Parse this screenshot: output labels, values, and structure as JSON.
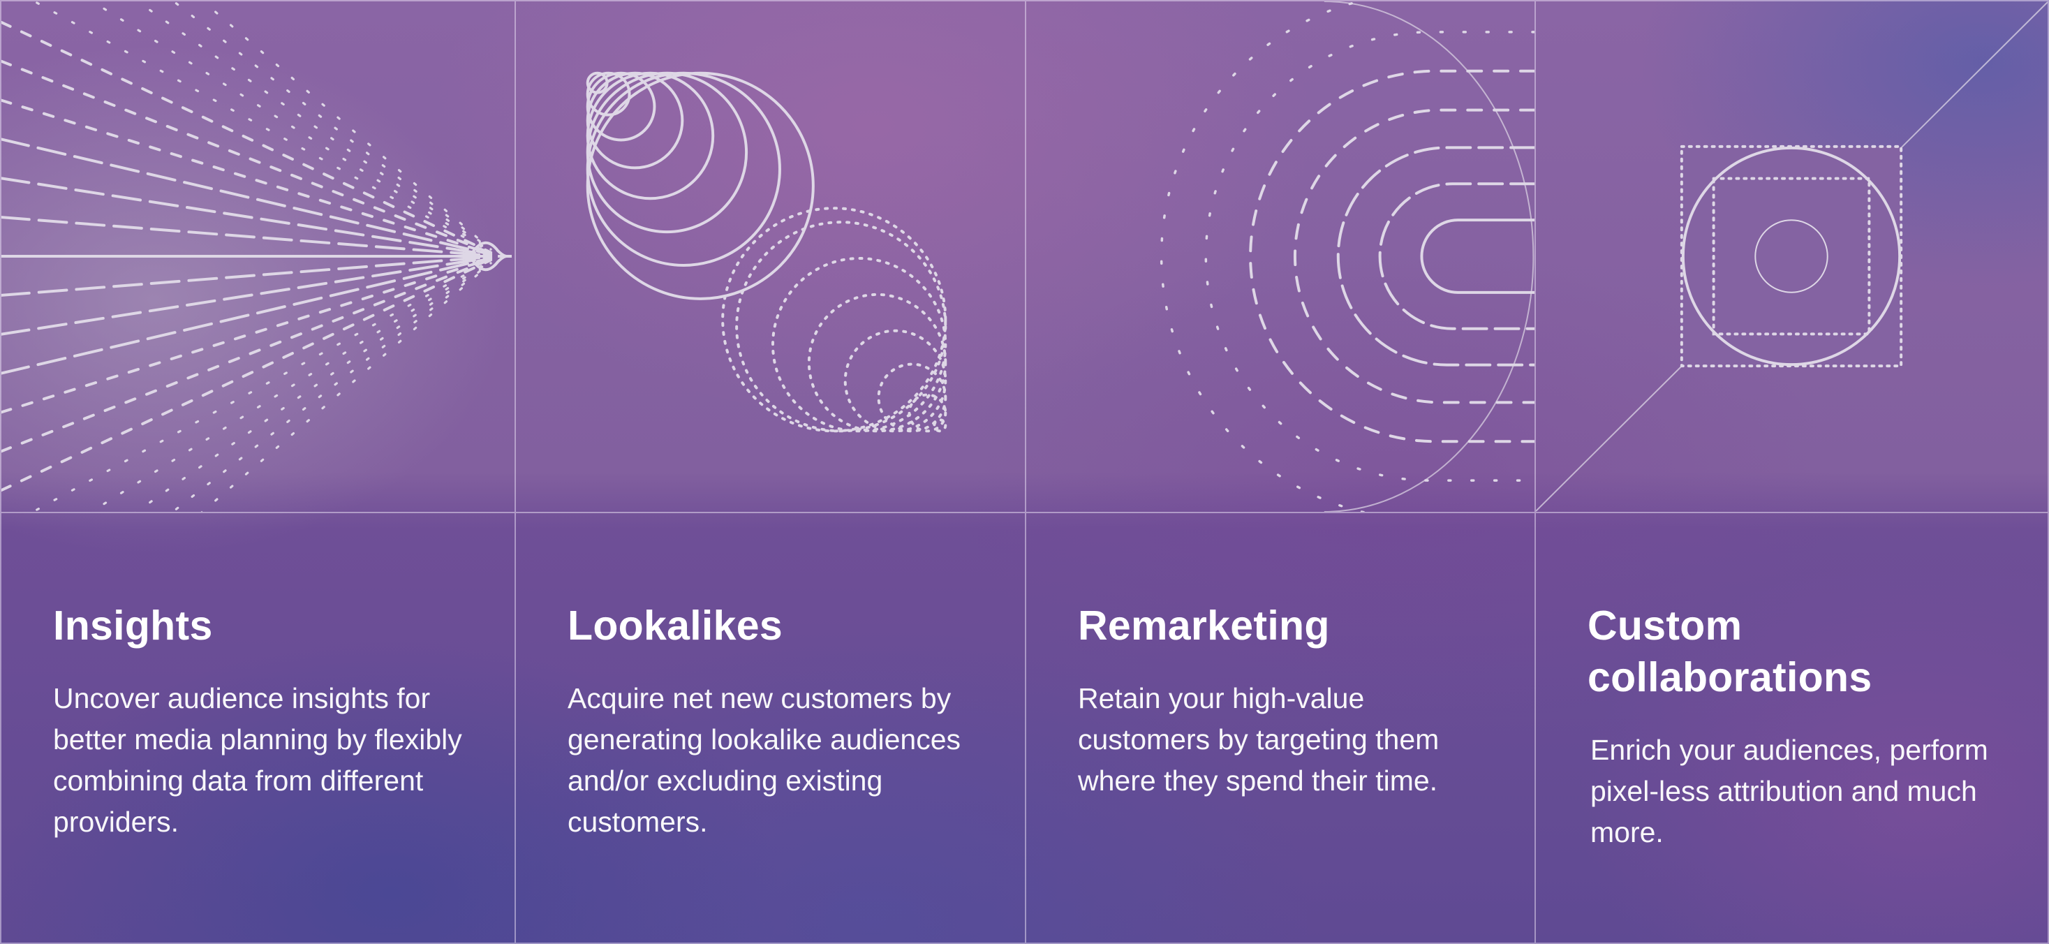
{
  "cards": [
    {
      "title": "Insights",
      "description": "Uncover audience insights for better media planning by flexibly combining data from different providers.",
      "illustration": "converging-dashed-lines-icon"
    },
    {
      "title": "Lookalikes",
      "description": "Acquire net new customers by generating lookalike audiences and/or excluding existing customers.",
      "illustration": "nested-circles-icon"
    },
    {
      "title": "Remarketing",
      "description": "Retain your high-value customers by targeting them where they spend their time.",
      "illustration": "nested-dashed-arcs-icon"
    },
    {
      "title": "Custom collaborations",
      "description": "Enrich your audiences, perform pixel-less attribution and much more.",
      "illustration": "square-circle-target-icon"
    }
  ],
  "colors": {
    "background_top": "#8a65a5",
    "background_bottom": "#5f4a93",
    "line": "#ded7e6",
    "text": "#ffffff"
  }
}
